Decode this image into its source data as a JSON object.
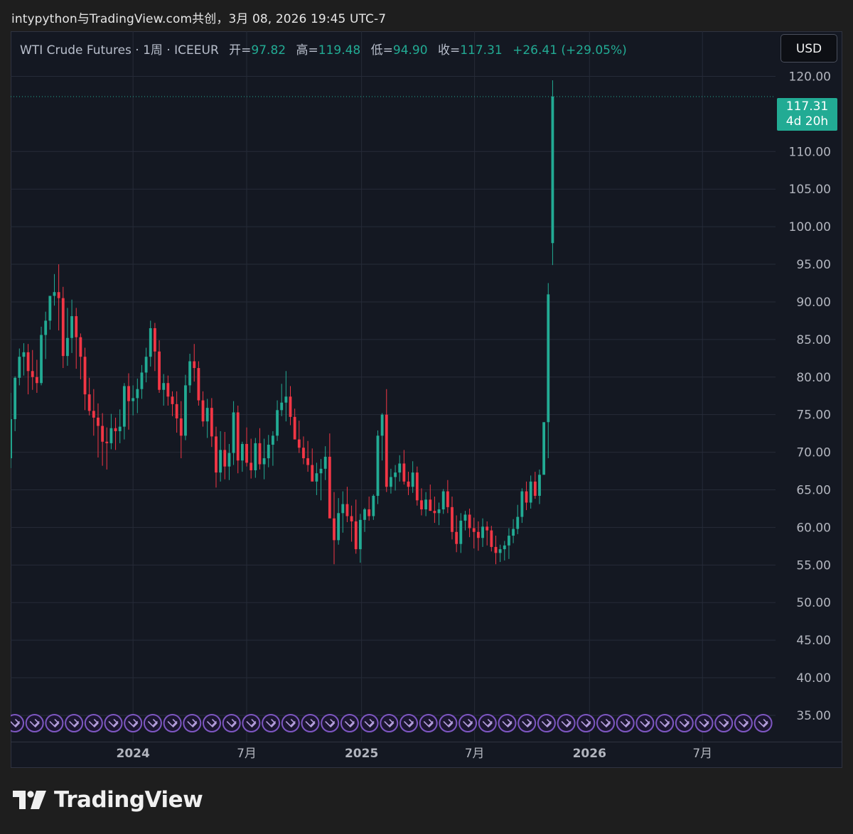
{
  "header": {
    "attribution": "intypython与TradingView.com共创，3月 08, 2026 19:45 UTC-7"
  },
  "legend": {
    "symbol": "WTI Crude Futures · 1周 · ICEEUR",
    "open_label": "开=",
    "open": "97.82",
    "high_label": "高=",
    "high": "119.48",
    "low_label": "低=",
    "low": "94.90",
    "close_label": "收=",
    "close": "117.31",
    "change": "+26.41 (+29.05%)"
  },
  "currency_button": "USD",
  "price_tag": {
    "price": "117.31",
    "countdown": "4d 20h"
  },
  "brand": "TradingView",
  "colors": {
    "up": "#22ab94",
    "down": "#f23645",
    "grid": "#262b38",
    "axis_text": "#b2b5be",
    "event_marker": "#7e57c2"
  },
  "chart_data": {
    "type": "candlestick",
    "title": "WTI Crude Futures · 1周 · ICEEUR",
    "ylim": [
      31.5,
      126
    ],
    "y_ticks": [
      "120.00",
      "110.00",
      "105.00",
      "100.00",
      "95.00",
      "90.00",
      "85.00",
      "80.00",
      "75.00",
      "70.00",
      "65.00",
      "60.00",
      "55.00",
      "50.00",
      "45.00",
      "40.00",
      "35.00"
    ],
    "x_ticks": [
      {
        "label": "2024",
        "date": "2024-01-01",
        "bold": true
      },
      {
        "label": "7月",
        "date": "2024-07-01",
        "bold": false
      },
      {
        "label": "2025",
        "date": "2025-01-01",
        "bold": true
      },
      {
        "label": "7月",
        "date": "2025-07-01",
        "bold": false
      },
      {
        "label": "2026",
        "date": "2026-01-01",
        "bold": true
      },
      {
        "label": "7月",
        "date": "2026-07-01",
        "bold": false
      }
    ],
    "x_range": [
      "2023-06-19",
      "2026-10-26"
    ],
    "first_candle_date": "2023-06-19",
    "interval": "1 week",
    "grid": true,
    "last_price_line": 117.31,
    "event_marker_count": 40,
    "candles": [
      [
        69.2,
        77.9,
        67.9,
        74.4
      ],
      [
        74.4,
        80.1,
        72.8,
        79.9
      ],
      [
        79.9,
        83.8,
        78.9,
        82.7
      ],
      [
        82.7,
        84.5,
        80.2,
        83.3
      ],
      [
        83.3,
        84.4,
        77.7,
        80.8
      ],
      [
        80.8,
        83.6,
        78.3,
        80.0
      ],
      [
        80.0,
        82.3,
        77.9,
        79.2
      ],
      [
        79.2,
        86.7,
        78.9,
        85.6
      ],
      [
        85.6,
        88.7,
        82.4,
        87.5
      ],
      [
        87.5,
        90.5,
        86.3,
        90.8
      ],
      [
        90.8,
        93.7,
        89.5,
        91.3
      ],
      [
        91.3,
        95.0,
        86.2,
        90.5
      ],
      [
        90.5,
        92.0,
        81.2,
        82.8
      ],
      [
        82.8,
        89.2,
        81.5,
        85.2
      ],
      [
        85.2,
        90.3,
        83.2,
        88.1
      ],
      [
        88.1,
        89.2,
        81.1,
        85.3
      ],
      [
        85.3,
        85.8,
        79.7,
        82.7
      ],
      [
        82.7,
        83.9,
        75.6,
        77.7
      ],
      [
        77.7,
        79.9,
        74.9,
        75.5
      ],
      [
        75.5,
        78.4,
        72.2,
        74.6
      ],
      [
        74.6,
        76.5,
        69.3,
        73.5
      ],
      [
        73.5,
        75.2,
        68.2,
        71.4
      ],
      [
        71.4,
        73.3,
        67.7,
        71.2
      ],
      [
        71.2,
        75.1,
        70.4,
        73.2
      ],
      [
        73.2,
        74.6,
        70.3,
        72.8
      ],
      [
        72.8,
        75.7,
        71.2,
        73.4
      ],
      [
        73.4,
        79.2,
        71.7,
        78.8
      ],
      [
        78.8,
        80.5,
        73.0,
        76.8
      ],
      [
        76.8,
        78.9,
        74.9,
        77.2
      ],
      [
        77.2,
        79.8,
        75.2,
        78.4
      ],
      [
        78.4,
        81.6,
        77.1,
        80.6
      ],
      [
        80.6,
        83.9,
        79.3,
        82.7
      ],
      [
        82.7,
        87.5,
        81.4,
        86.5
      ],
      [
        86.5,
        87.2,
        80.8,
        83.4
      ],
      [
        83.4,
        84.9,
        77.9,
        78.3
      ],
      [
        78.3,
        80.4,
        76.2,
        79.2
      ],
      [
        79.2,
        80.2,
        76.2,
        77.4
      ],
      [
        77.4,
        78.1,
        74.8,
        76.4
      ],
      [
        76.4,
        78.1,
        72.6,
        74.5
      ],
      [
        74.5,
        76.8,
        69.2,
        72.2
      ],
      [
        72.2,
        80.3,
        71.6,
        78.9
      ],
      [
        78.9,
        83.1,
        77.9,
        82.1
      ],
      [
        82.1,
        84.4,
        79.4,
        81.2
      ],
      [
        81.2,
        82.1,
        76.2,
        76.9
      ],
      [
        76.9,
        78.1,
        73.4,
        74.1
      ],
      [
        74.1,
        77.1,
        71.9,
        75.9
      ],
      [
        75.9,
        77.2,
        70.7,
        72.1
      ],
      [
        72.1,
        73.4,
        65.3,
        67.3
      ],
      [
        67.3,
        72.8,
        66.1,
        70.3
      ],
      [
        70.3,
        72.7,
        66.4,
        68.1
      ],
      [
        68.1,
        71.1,
        66.3,
        69.9
      ],
      [
        69.9,
        76.8,
        68.3,
        75.3
      ],
      [
        75.3,
        76.2,
        67.2,
        68.9
      ],
      [
        68.9,
        71.4,
        67.4,
        71.1
      ],
      [
        71.1,
        73.3,
        68.1,
        68.6
      ],
      [
        68.6,
        71.8,
        66.5,
        67.6
      ],
      [
        67.6,
        71.9,
        66.6,
        71.2
      ],
      [
        71.2,
        73.2,
        67.7,
        68.4
      ],
      [
        68.4,
        71.8,
        66.4,
        69.2
      ],
      [
        69.2,
        72.3,
        68.0,
        71.0
      ],
      [
        71.0,
        72.8,
        68.2,
        72.2
      ],
      [
        72.2,
        76.9,
        71.5,
        75.6
      ],
      [
        75.6,
        79.1,
        74.8,
        76.6
      ],
      [
        76.6,
        80.8,
        74.1,
        77.4
      ],
      [
        77.4,
        78.8,
        73.6,
        74.7
      ],
      [
        74.7,
        75.8,
        72.2,
        71.7
      ],
      [
        71.7,
        74.2,
        69.9,
        70.6
      ],
      [
        70.6,
        72.1,
        68.4,
        69.2
      ],
      [
        69.2,
        71.5,
        67.4,
        68.3
      ],
      [
        68.3,
        70.5,
        66.7,
        66.1
      ],
      [
        66.1,
        68.6,
        64.3,
        67.2
      ],
      [
        67.2,
        69.1,
        63.6,
        67.8
      ],
      [
        67.8,
        70.8,
        66.3,
        69.4
      ],
      [
        69.4,
        72.5,
        65.3,
        61.2
      ],
      [
        61.2,
        64.7,
        55.1,
        58.3
      ],
      [
        58.3,
        63.9,
        57.7,
        61.9
      ],
      [
        61.9,
        64.8,
        59.3,
        63.1
      ],
      [
        63.1,
        65.4,
        60.7,
        61.5
      ],
      [
        61.5,
        62.9,
        58.1,
        60.8
      ],
      [
        60.8,
        63.7,
        56.5,
        57.1
      ],
      [
        57.1,
        61.8,
        55.3,
        61.0
      ],
      [
        61.0,
        62.6,
        59.4,
        62.4
      ],
      [
        62.4,
        64.1,
        60.9,
        61.5
      ],
      [
        61.5,
        64.4,
        61.0,
        64.2
      ],
      [
        64.2,
        72.9,
        63.1,
        72.2
      ],
      [
        72.2,
        75.2,
        68.9,
        75.0
      ],
      [
        75.0,
        78.4,
        64.7,
        65.4
      ],
      [
        65.4,
        67.8,
        64.5,
        66.7
      ],
      [
        66.7,
        68.3,
        64.9,
        67.3
      ],
      [
        67.3,
        69.6,
        66.1,
        68.5
      ],
      [
        68.5,
        70.3,
        65.7,
        66.1
      ],
      [
        66.1,
        67.4,
        64.3,
        65.4
      ],
      [
        65.4,
        68.8,
        64.6,
        67.3
      ],
      [
        67.3,
        68.1,
        62.9,
        63.6
      ],
      [
        63.6,
        65.2,
        61.6,
        62.4
      ],
      [
        62.4,
        64.7,
        61.5,
        63.7
      ],
      [
        63.7,
        65.7,
        62.2,
        62.2
      ],
      [
        62.2,
        64.1,
        60.6,
        61.9
      ],
      [
        61.9,
        63.3,
        60.3,
        62.4
      ],
      [
        62.4,
        65.1,
        61.8,
        64.8
      ],
      [
        64.8,
        66.3,
        61.9,
        62.7
      ],
      [
        62.7,
        64.1,
        58.4,
        59.4
      ],
      [
        59.4,
        61.6,
        56.7,
        57.8
      ],
      [
        57.8,
        61.9,
        56.6,
        60.9
      ],
      [
        60.9,
        62.2,
        59.6,
        61.7
      ],
      [
        61.7,
        62.5,
        58.7,
        59.9
      ],
      [
        59.9,
        61.3,
        57.2,
        59.4
      ],
      [
        59.4,
        60.8,
        56.9,
        58.6
      ],
      [
        58.6,
        61.2,
        57.4,
        60.1
      ],
      [
        60.1,
        60.8,
        57.6,
        59.6
      ],
      [
        59.6,
        60.2,
        56.8,
        57.4
      ],
      [
        57.4,
        58.9,
        55.1,
        56.6
      ],
      [
        56.6,
        57.7,
        55.4,
        57.1
      ],
      [
        57.1,
        58.2,
        55.6,
        57.6
      ],
      [
        57.6,
        59.9,
        55.8,
        58.9
      ],
      [
        58.9,
        61.1,
        57.9,
        59.8
      ],
      [
        59.8,
        63.0,
        59.1,
        61.4
      ],
      [
        61.4,
        65.2,
        60.6,
        64.8
      ],
      [
        64.8,
        66.1,
        62.3,
        63.3
      ],
      [
        63.3,
        66.9,
        62.5,
        66.1
      ],
      [
        66.1,
        67.4,
        63.8,
        64.2
      ],
      [
        64.2,
        67.7,
        63.1,
        67.0
      ],
      [
        67.0,
        67.5,
        69.2,
        74.0
      ],
      [
        74.0,
        92.5,
        69.2,
        91.0
      ],
      [
        97.82,
        119.48,
        94.9,
        117.31
      ]
    ]
  }
}
